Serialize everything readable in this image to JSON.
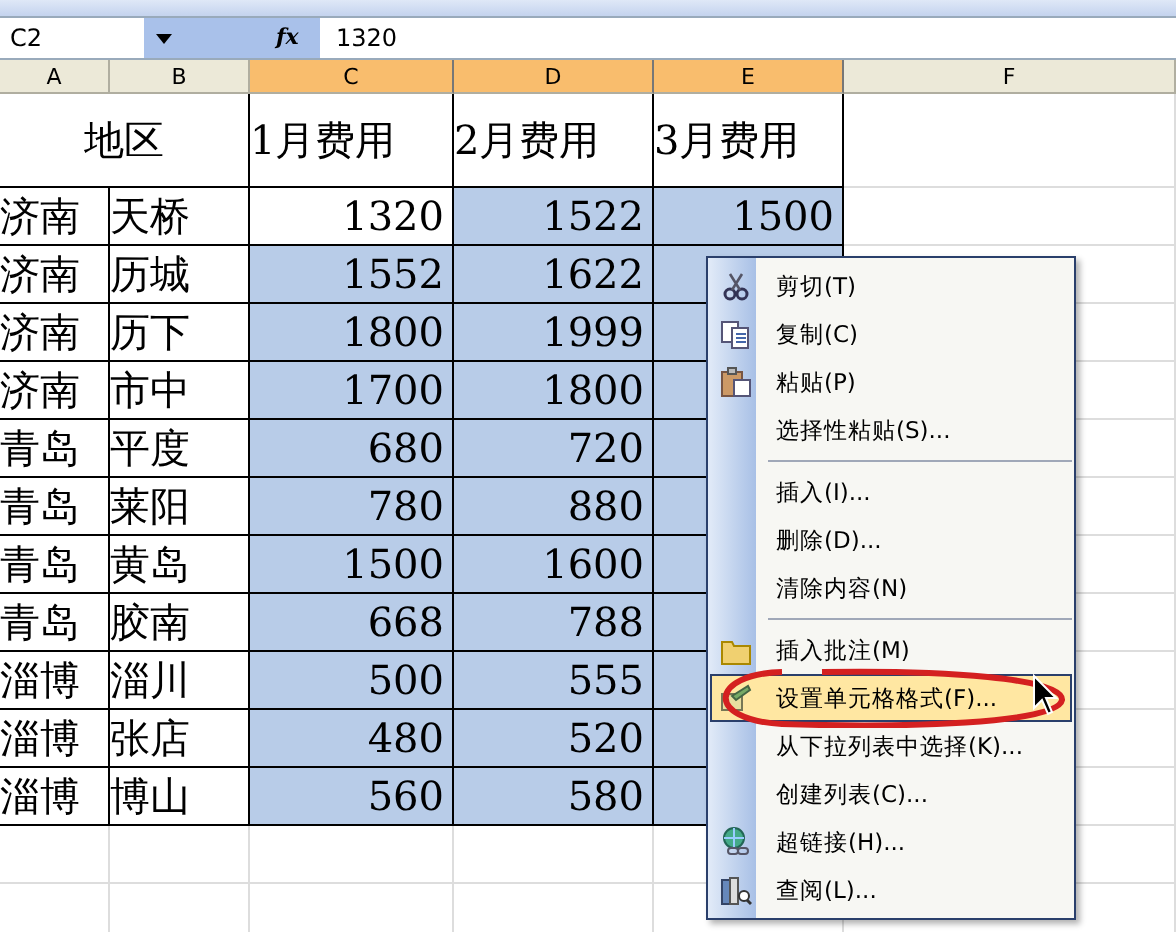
{
  "name_box": "C2",
  "function_label": "fx",
  "formula": "1320",
  "columns": [
    {
      "label": "A",
      "selected": false
    },
    {
      "label": "B",
      "selected": false
    },
    {
      "label": "C",
      "selected": true
    },
    {
      "label": "D",
      "selected": true
    },
    {
      "label": "E",
      "selected": true
    },
    {
      "label": "F",
      "selected": false
    }
  ],
  "header_row": {
    "region": "地区",
    "months": [
      "1月费用",
      "2月费用",
      "3月费用"
    ]
  },
  "rows": [
    {
      "city": "济南",
      "district": "天桥",
      "cells": [
        {
          "text": "1320",
          "selected": false
        },
        {
          "text": "1522",
          "selected": true
        },
        {
          "text": "1500",
          "selected": true
        }
      ]
    },
    {
      "city": "济南",
      "district": "历城",
      "cells": [
        {
          "text": "1552",
          "selected": true
        },
        {
          "text": "1622",
          "selected": true
        },
        {
          "selected": true
        }
      ]
    },
    {
      "city": "济南",
      "district": "历下",
      "cells": [
        {
          "text": "1800",
          "selected": true
        },
        {
          "text": "1999",
          "selected": true
        },
        {
          "selected": true
        }
      ]
    },
    {
      "city": "济南",
      "district": "市中",
      "cells": [
        {
          "text": "1700",
          "selected": true
        },
        {
          "text": "1800",
          "selected": true
        },
        {
          "selected": true
        }
      ]
    },
    {
      "city": "青岛",
      "district": "平度",
      "cells": [
        {
          "text": "680",
          "selected": true
        },
        {
          "text": "720",
          "selected": true
        },
        {
          "selected": true
        }
      ]
    },
    {
      "city": "青岛",
      "district": "莱阳",
      "cells": [
        {
          "text": "780",
          "selected": true
        },
        {
          "text": "880",
          "selected": true
        },
        {
          "selected": true
        }
      ]
    },
    {
      "city": "青岛",
      "district": "黄岛",
      "cells": [
        {
          "text": "1500",
          "selected": true
        },
        {
          "text": "1600",
          "selected": true
        },
        {
          "selected": true
        }
      ]
    },
    {
      "city": "青岛",
      "district": "胶南",
      "cells": [
        {
          "text": "668",
          "selected": true
        },
        {
          "text": "788",
          "selected": true
        },
        {
          "selected": true
        }
      ]
    },
    {
      "city": "淄博",
      "district": "淄川",
      "cells": [
        {
          "text": "500",
          "selected": true
        },
        {
          "text": "555",
          "selected": true
        },
        {
          "selected": true
        }
      ]
    },
    {
      "city": "淄博",
      "district": "张店",
      "cells": [
        {
          "text": "480",
          "selected": true
        },
        {
          "text": "520",
          "selected": true
        },
        {
          "selected": true
        }
      ]
    },
    {
      "city": "淄博",
      "district": "博山",
      "cells": [
        {
          "text": "560",
          "selected": true
        },
        {
          "text": "580",
          "selected": true
        },
        {
          "selected": true
        }
      ]
    }
  ],
  "context_menu": [
    {
      "label": "剪切(T)",
      "selected": false,
      "separator_before": false
    },
    {
      "label": "复制(C)",
      "selected": false,
      "separator_before": false
    },
    {
      "label": "粘贴(P)",
      "selected": false,
      "separator_before": false
    },
    {
      "label": "选择性粘贴(S)...",
      "selected": false,
      "separator_before": false
    },
    {
      "label": "插入(I)...",
      "selected": false,
      "separator_before": true
    },
    {
      "label": "删除(D)...",
      "selected": false,
      "separator_before": false
    },
    {
      "label": "清除内容(N)",
      "selected": false,
      "separator_before": false
    },
    {
      "label": "插入批注(M)",
      "selected": false,
      "separator_before": true
    },
    {
      "label": "设置单元格格式(F)...",
      "selected": true,
      "separator_before": false
    },
    {
      "label": "从下拉列表中选择(K)...",
      "selected": false,
      "separator_before": false
    },
    {
      "label": "创建列表(C)...",
      "selected": false,
      "separator_before": false
    },
    {
      "label": "超链接(H)...",
      "selected": false,
      "separator_before": false
    },
    {
      "label": "查阅(L)...",
      "selected": false,
      "separator_before": false
    }
  ]
}
